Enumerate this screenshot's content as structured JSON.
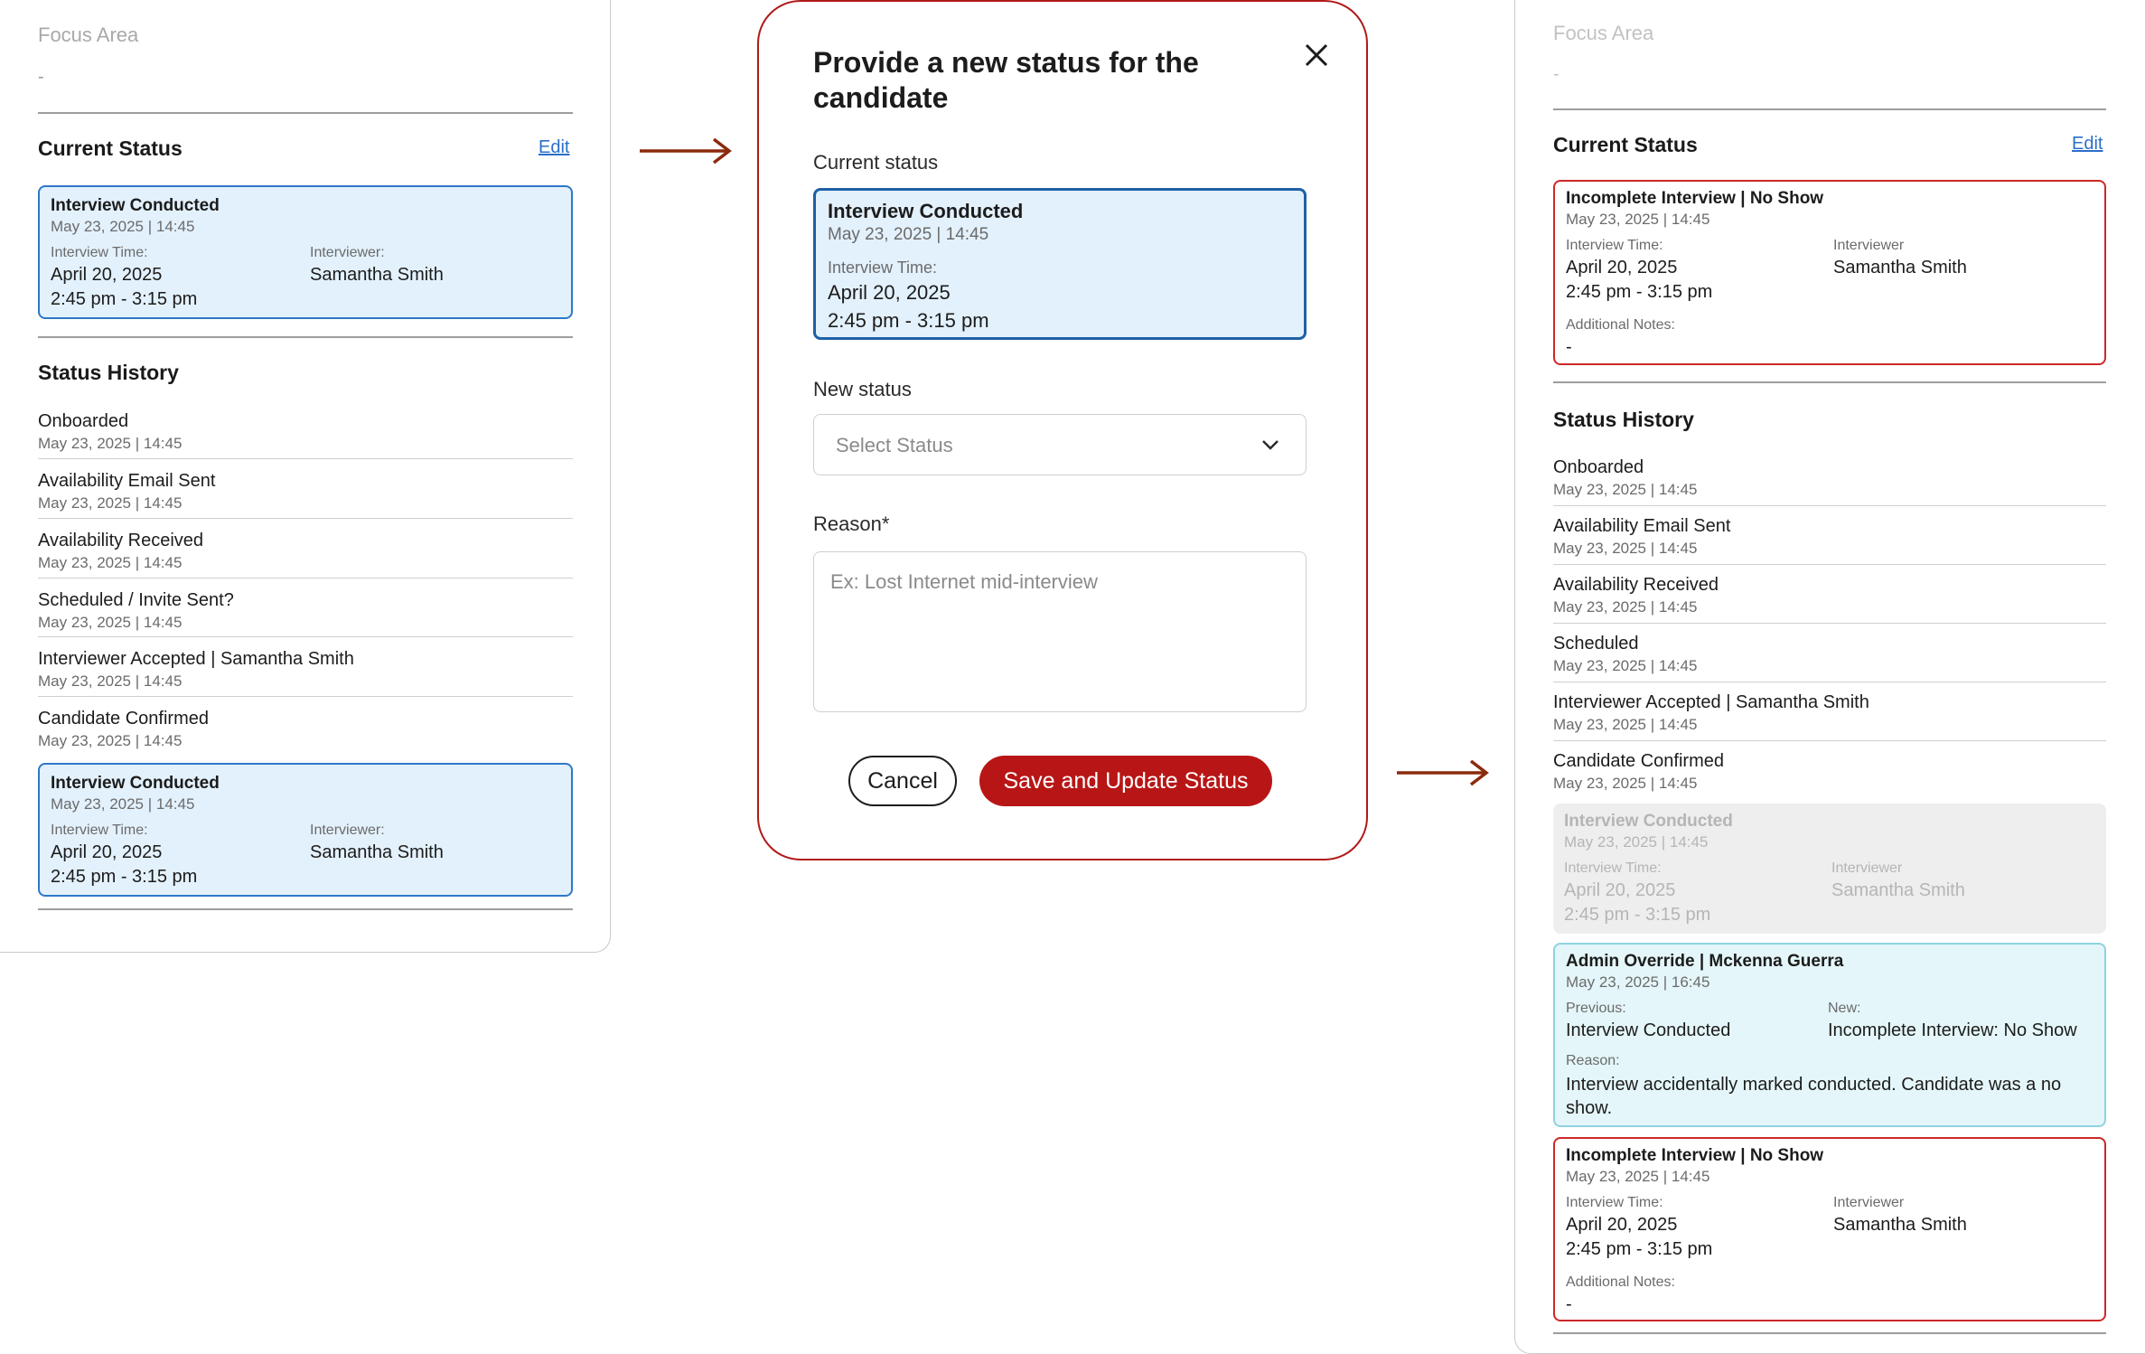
{
  "colors": {
    "accent_red": "#b81616",
    "card_blue_bg": "#e3f1fc",
    "card_blue_border": "#2d78c8",
    "card_red_border": "#cc2828",
    "card_teal_bg": "#e4f6f9",
    "arrow": "#8b2a0c",
    "link": "#2a6fc9"
  },
  "icons": {
    "close": "close-icon",
    "chevron": "chevron-down-icon",
    "flow_arrow": "arrow-right-icon"
  },
  "left": {
    "focus_label": "Focus Area",
    "focus_value": "-",
    "current_status_title": "Current Status",
    "edit_label": "Edit",
    "current_card": {
      "title": "Interview Conducted",
      "meta": "May 23, 2025  |  14:45",
      "time_label": "Interview Time:",
      "date": "April 20, 2025",
      "time": "2:45 pm - 3:15 pm",
      "interviewer_label": "Interviewer:",
      "interviewer": "Samantha Smith"
    },
    "history_title": "Status History",
    "history": [
      {
        "name": "Onboarded",
        "date": "May 23, 2025  |  14:45"
      },
      {
        "name": "Availability Email Sent",
        "date": "May 23, 2025  |  14:45"
      },
      {
        "name": "Availability Received",
        "date": "May 23, 2025  |  14:45"
      },
      {
        "name": "Scheduled / Invite Sent?",
        "date": "May 23, 2025  |  14:45"
      },
      {
        "name": "Interviewer Accepted  |  Samantha Smith",
        "date": "May 23, 2025  |  14:45"
      },
      {
        "name": "Candidate Confirmed",
        "date": "May 23, 2025  |  14:45"
      }
    ],
    "history_card": {
      "title": "Interview Conducted",
      "meta": "May 23, 2025  |  14:45",
      "time_label": "Interview Time:",
      "date": "April 20, 2025",
      "time": "2:45 pm - 3:15 pm",
      "interviewer_label": "Interviewer:",
      "interviewer": "Samantha Smith"
    }
  },
  "modal": {
    "title": "Provide a new status for the candidate",
    "current_status_label": "Current status",
    "current_card": {
      "title": "Interview Conducted",
      "meta": "May 23, 2025  |  14:45",
      "time_label": "Interview Time:",
      "date": "April 20, 2025",
      "time": "2:45 pm - 3:15 pm"
    },
    "new_status_label": "New status",
    "select_placeholder": "Select Status",
    "reason_label": "Reason*",
    "reason_placeholder": "Ex: Lost Internet mid-interview",
    "cancel_label": "Cancel",
    "save_label": "Save and Update Status"
  },
  "right": {
    "focus_label": "Focus Area",
    "focus_value": "-",
    "current_status_title": "Current Status",
    "edit_label": "Edit",
    "current_card": {
      "title": "Incomplete Interview  |  No Show",
      "meta": "May 23, 2025  |  14:45",
      "time_label": "Interview Time:",
      "date": "April 20, 2025",
      "time": "2:45 pm - 3:15 pm",
      "interviewer_label": "Interviewer",
      "interviewer": "Samantha Smith",
      "notes_label": "Additional Notes:",
      "notes": "-"
    },
    "history_title": "Status History",
    "history": [
      {
        "name": "Onboarded",
        "date": "May 23, 2025  |  14:45"
      },
      {
        "name": "Availability Email Sent",
        "date": "May 23, 2025  |  14:45"
      },
      {
        "name": "Availability Received",
        "date": "May 23, 2025  |  14:45"
      },
      {
        "name": "Scheduled",
        "date": "May 23, 2025  |  14:45"
      },
      {
        "name": "Interviewer Accepted  |  Samantha Smith",
        "date": "May 23, 2025  |  14:45"
      },
      {
        "name": "Candidate Confirmed",
        "date": "May 23, 2025  |  14:45"
      }
    ],
    "grey_card": {
      "title": "Interview Conducted",
      "meta": "May 23, 2025  |  14:45",
      "time_label": "Interview Time:",
      "date": "April 20, 2025",
      "time": "2:45 pm - 3:15 pm",
      "interviewer_label": "Interviewer",
      "interviewer": "Samantha Smith"
    },
    "override_card": {
      "title": "Admin Override  |  Mckenna Guerra",
      "meta": "May 23, 2025  |  16:45",
      "previous_label": "Previous:",
      "previous": "Interview Conducted",
      "new_label": "New:",
      "new": "Incomplete Interview: No Show",
      "reason_label": "Reason:",
      "reason": "Interview accidentally marked conducted. Candidate was a no show."
    },
    "incomplete_card": {
      "title": "Incomplete Interview  |  No Show",
      "meta": "May 23, 2025  |  14:45",
      "time_label": "Interview Time:",
      "date": "April 20, 2025",
      "time": "2:45 pm - 3:15 pm",
      "interviewer_label": "Interviewer",
      "interviewer": "Samantha Smith",
      "notes_label": "Additional Notes:",
      "notes": "-"
    }
  }
}
